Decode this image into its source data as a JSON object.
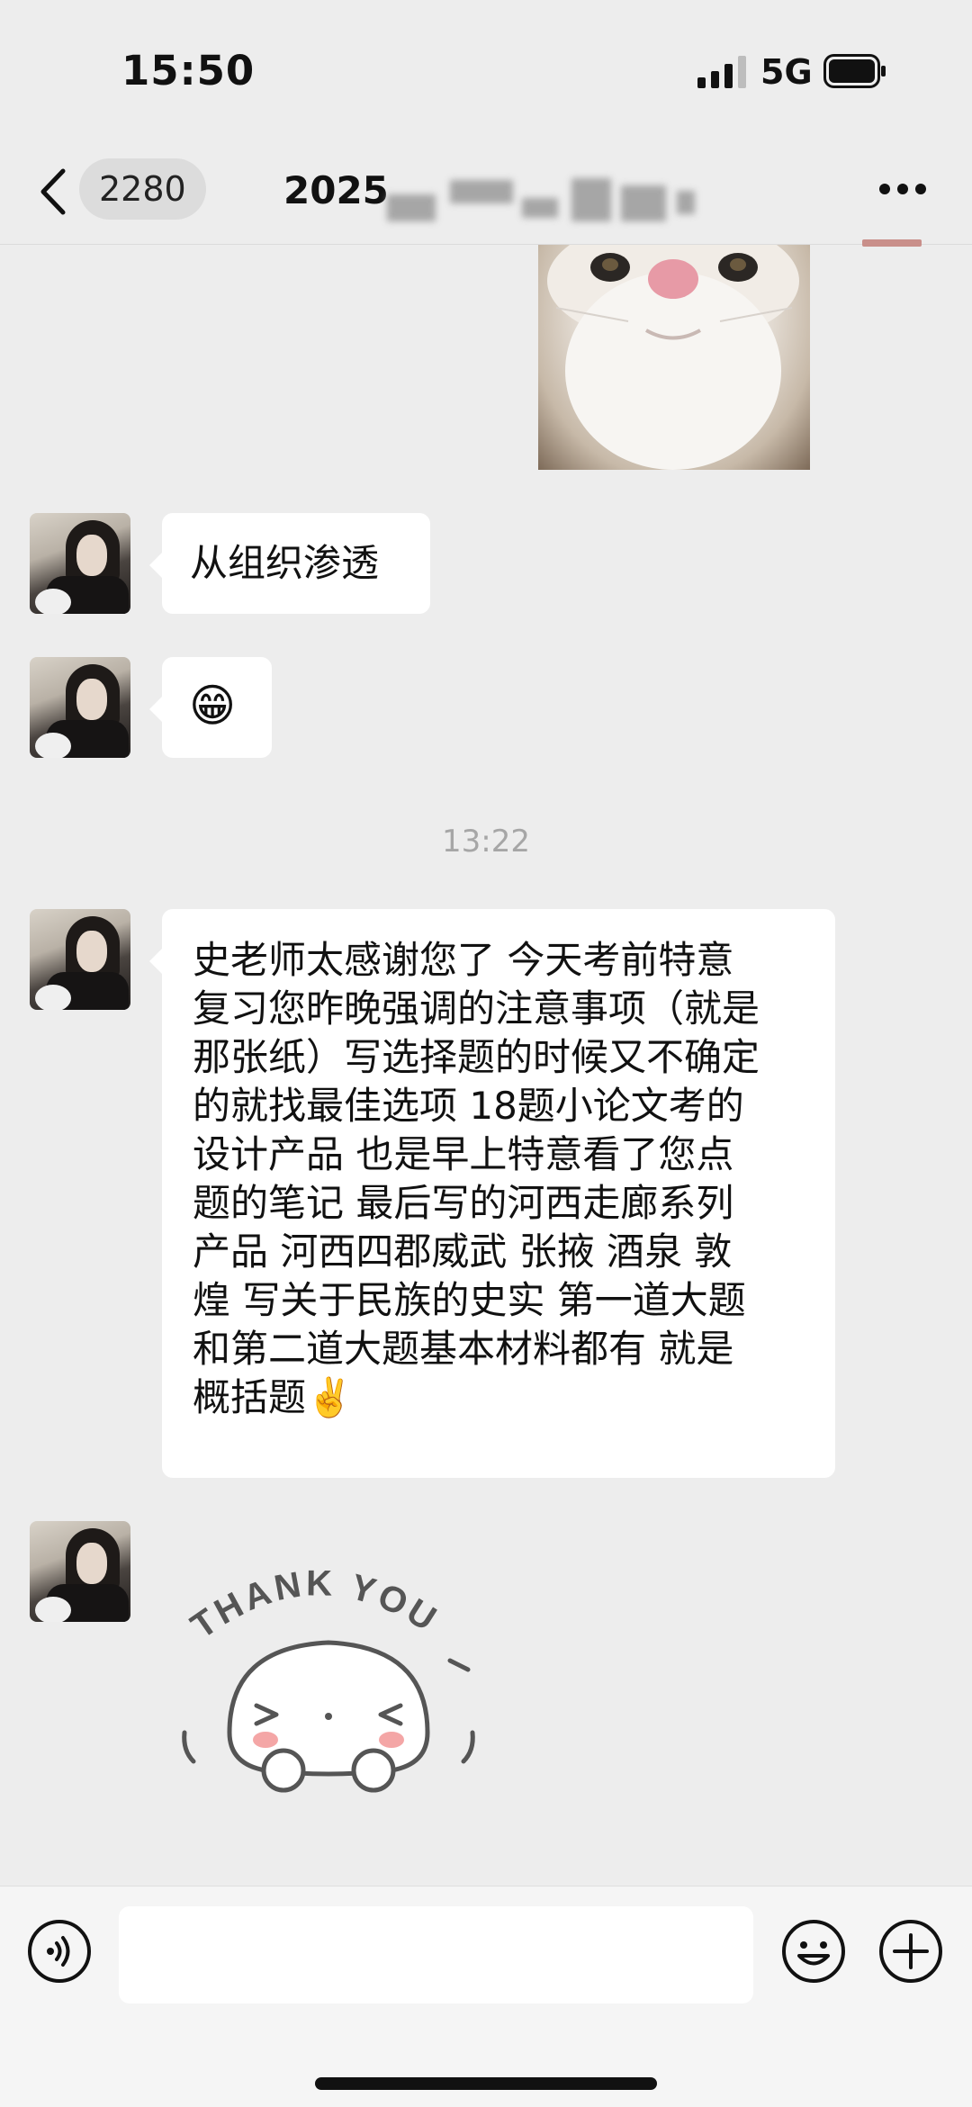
{
  "status_bar": {
    "time": "15:50",
    "network": "5G"
  },
  "nav": {
    "unread_count": "2280",
    "title_visible": "2025"
  },
  "messages": [
    {
      "type": "text",
      "text": "从组织渗透"
    },
    {
      "type": "emoji",
      "text": "😁"
    },
    {
      "type": "time",
      "text": "13:22"
    },
    {
      "type": "text",
      "lines": [
        "史老师太感谢您了 今天考前特意",
        "复习您昨晚强调的注意事项（就是",
        "那张纸）写选择题的时候又不确定",
        "的就找最佳选项 18题小论文考的",
        "设计产品 也是早上特意看了您点",
        "题的笔记 最后写的河西走廊系列",
        "产品 河西四郡威武 张掖 酒泉 敦",
        "煌 写关于民族的史实 第一道大题",
        "和第二道大题基本材料都有 就是",
        "概括题✌️"
      ]
    },
    {
      "type": "sticker",
      "text": "THANK YOU"
    }
  ],
  "input": {
    "placeholder": ""
  },
  "icons": [
    "back-icon",
    "more-icon",
    "signal-icon",
    "battery-icon",
    "voice-icon",
    "emoji-icon",
    "plus-icon"
  ],
  "colors": {
    "background": "#ededed",
    "bubble": "#ffffff",
    "time_divider": "#a6a6a6"
  }
}
